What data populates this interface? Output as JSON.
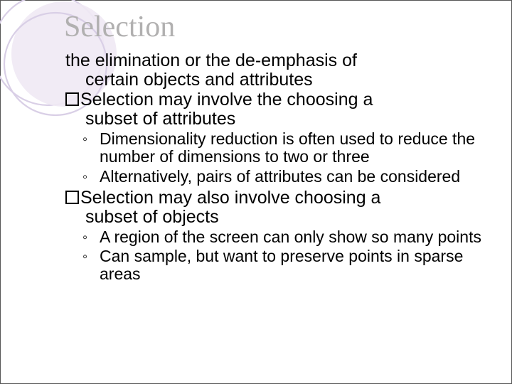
{
  "title": "Selection",
  "lines": {
    "intro1": "the elimination or the de-emphasis of",
    "intro2": "certain objects and attributes",
    "l1a": "Selection may involve the choosing a",
    "l1a_cont": "subset of attributes",
    "l1b": "Selection may also involve choosing a",
    "l1b_cont": "subset of objects"
  },
  "sub_a": [
    "Dimensionality reduction is often used to reduce the number of dimensions to two or three",
    "Alternatively, pairs of attributes can be considered"
  ],
  "sub_b": [
    " A region of the screen can only show so many points",
    "Can sample, but want to preserve points in sparse areas"
  ],
  "bullet_char": "◦"
}
